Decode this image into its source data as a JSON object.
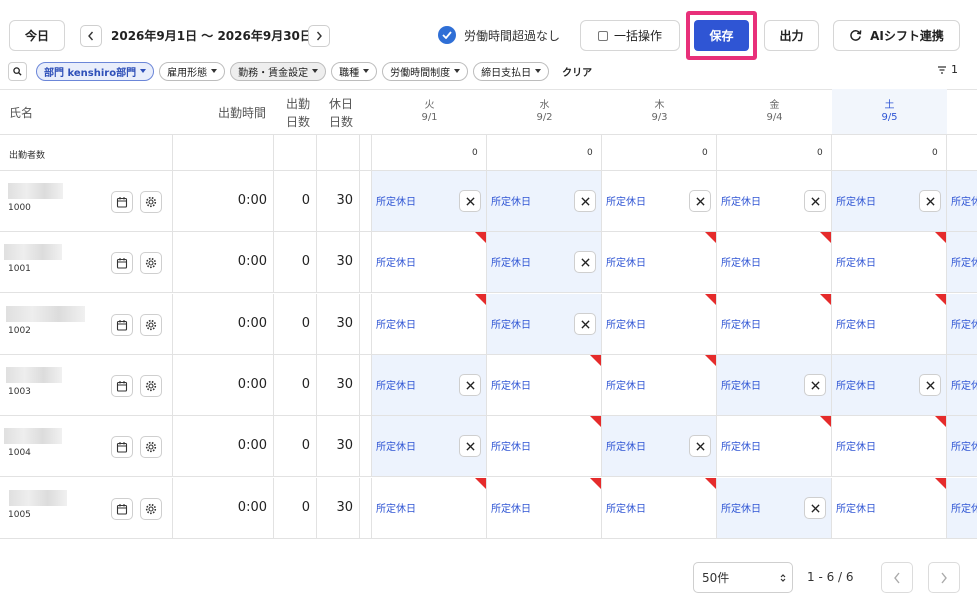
{
  "toolbar": {
    "today_label": "今日",
    "date_range": "2026年9月1日 〜 2026年9月30日",
    "overtime_label": "労働時間超過なし",
    "bulk_label": "一括操作",
    "save_label": "保存",
    "export_label": "出力",
    "ai_label": "AIシフト連携"
  },
  "filters": [
    {
      "label": "部門 kenshiro部門",
      "state": "active"
    },
    {
      "label": "雇用形態",
      "state": "normal"
    },
    {
      "label": "勤務・賃金設定",
      "state": "gray"
    },
    {
      "label": "職種",
      "state": "normal"
    },
    {
      "label": "労働時間制度",
      "state": "normal"
    },
    {
      "label": "締日支払日",
      "state": "normal"
    }
  ],
  "clear_label": "クリア",
  "sort_count": "1",
  "table": {
    "col_name": "氏名",
    "col_work_time": "出勤時間",
    "col_work_days": [
      "出勤",
      "日数"
    ],
    "col_off_days": [
      "休日",
      "日数"
    ],
    "attendance_label": "出勤者数",
    "days": [
      {
        "dow": "火",
        "date": "9/1",
        "count": "0",
        "sat": false
      },
      {
        "dow": "水",
        "date": "9/2",
        "count": "0",
        "sat": false
      },
      {
        "dow": "木",
        "date": "9/3",
        "count": "0",
        "sat": false
      },
      {
        "dow": "金",
        "date": "9/4",
        "count": "0",
        "sat": false
      },
      {
        "dow": "土",
        "date": "9/5",
        "count": "0",
        "sat": true
      }
    ],
    "cell_label": "所定休日",
    "rows": [
      {
        "id": "1000",
        "time": "0:00",
        "work": "0",
        "off": "30",
        "hol": [
          1,
          1,
          0,
          0,
          1,
          1
        ],
        "xbtn": [
          1,
          1,
          1,
          1,
          1
        ],
        "tri": [
          0,
          0,
          0,
          0,
          0
        ]
      },
      {
        "id": "1001",
        "time": "0:00",
        "work": "0",
        "off": "30",
        "hol": [
          0,
          1,
          0,
          0,
          0,
          1
        ],
        "xbtn": [
          0,
          1,
          0,
          0,
          0
        ],
        "tri": [
          1,
          0,
          1,
          1,
          1
        ]
      },
      {
        "id": "1002",
        "time": "0:00",
        "work": "0",
        "off": "30",
        "hol": [
          0,
          1,
          0,
          0,
          0,
          1
        ],
        "xbtn": [
          0,
          1,
          0,
          0,
          0
        ],
        "tri": [
          1,
          0,
          1,
          1,
          1
        ]
      },
      {
        "id": "1003",
        "time": "0:00",
        "work": "0",
        "off": "30",
        "hol": [
          1,
          0,
          0,
          1,
          1,
          1
        ],
        "xbtn": [
          1,
          0,
          0,
          1,
          1
        ],
        "tri": [
          0,
          1,
          1,
          0,
          0
        ]
      },
      {
        "id": "1004",
        "time": "0:00",
        "work": "0",
        "off": "30",
        "hol": [
          1,
          0,
          1,
          0,
          0,
          1
        ],
        "xbtn": [
          1,
          0,
          1,
          0,
          0
        ],
        "tri": [
          0,
          1,
          0,
          1,
          1
        ]
      },
      {
        "id": "1005",
        "time": "0:00",
        "work": "0",
        "off": "30",
        "hol": [
          0,
          0,
          0,
          1,
          0,
          1
        ],
        "xbtn": [
          0,
          0,
          0,
          1,
          0
        ],
        "tri": [
          1,
          1,
          1,
          0,
          1
        ]
      }
    ]
  },
  "footer": {
    "per_page": "50件",
    "range": "1 - 6 / 6"
  },
  "colors": {
    "accent": "#2f55d4",
    "highlight_outline": "#e8307a",
    "flag": "#e52b2b",
    "holiday_bg": "#edf3fd"
  }
}
